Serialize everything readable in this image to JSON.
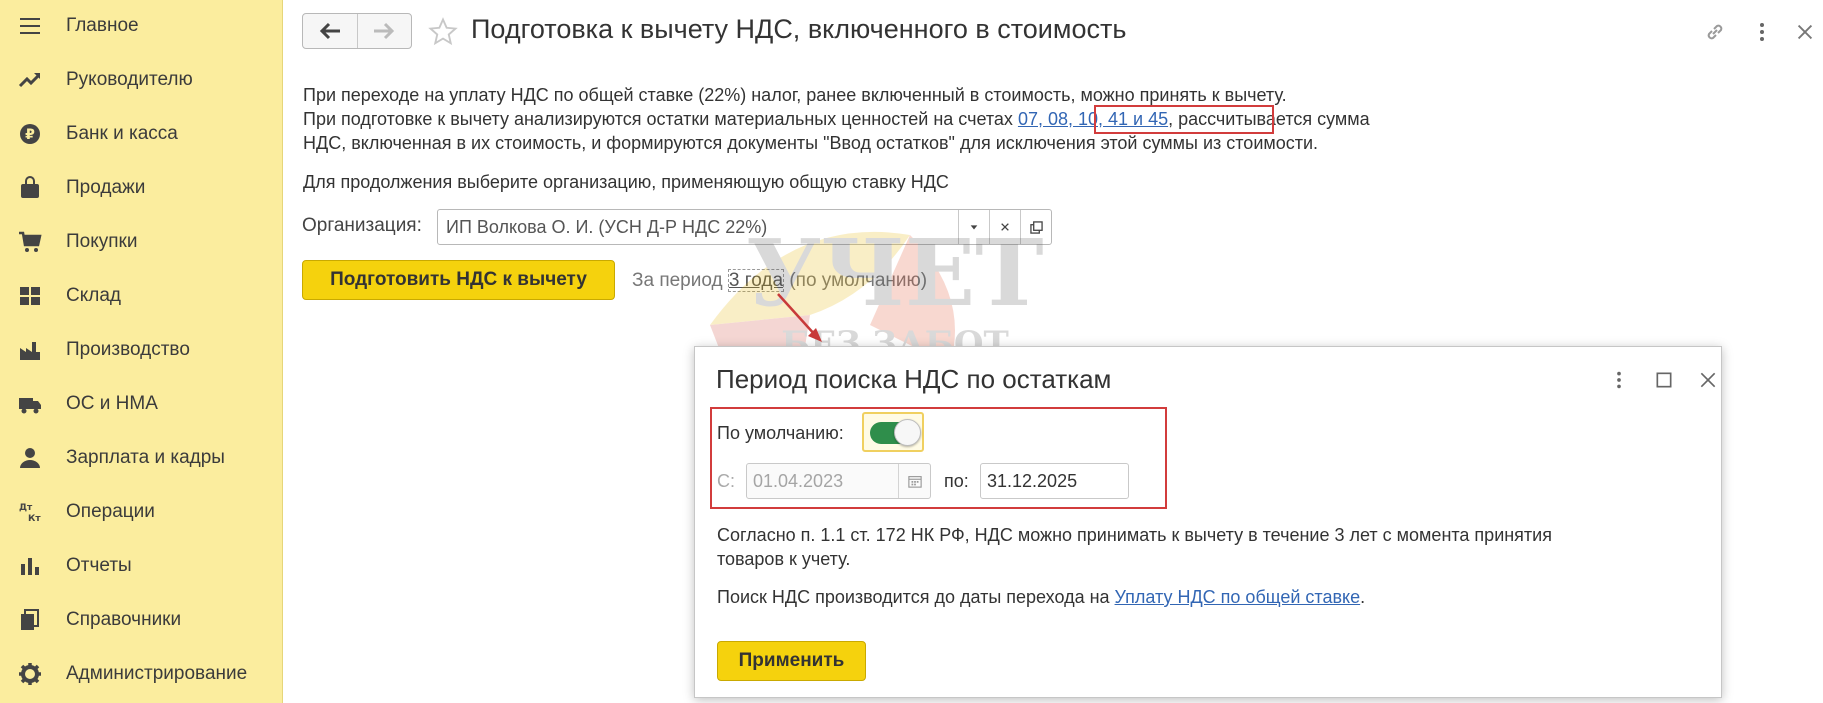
{
  "sidebar": {
    "items": [
      {
        "label": "Главное",
        "icon": "menu-icon"
      },
      {
        "label": "Руководителю",
        "icon": "trend-icon"
      },
      {
        "label": "Банк и касса",
        "icon": "ruble-icon"
      },
      {
        "label": "Продажи",
        "icon": "shopping-bag-icon"
      },
      {
        "label": "Покупки",
        "icon": "cart-icon"
      },
      {
        "label": "Склад",
        "icon": "warehouse-icon"
      },
      {
        "label": "Производство",
        "icon": "factory-icon"
      },
      {
        "label": "ОС и НМА",
        "icon": "truck-icon"
      },
      {
        "label": "Зарплата и кадры",
        "icon": "person-icon"
      },
      {
        "label": "Операции",
        "icon": "dt-kt-icon"
      },
      {
        "label": "Отчеты",
        "icon": "bar-chart-icon"
      },
      {
        "label": "Справочники",
        "icon": "books-icon"
      },
      {
        "label": "Администрирование",
        "icon": "gear-icon"
      }
    ]
  },
  "header": {
    "title": "Подготовка к вычету НДС, включенного в стоимость"
  },
  "intro": {
    "line1": "При переходе на уплату НДС по общей ставке (22%) налог, ранее включенный в стоимость, можно принять к вычету.",
    "line2_before": "При подготовке к вычету анализируются остатки материальных ценностей на счетах ",
    "accounts_link": "07, 08, 10, 41 и 45",
    "line2_after": ", рассчитывается сумма",
    "line3": "НДС, включенная в их стоимость, и формируются документы \"Ввод остатков\" для исключения этой суммы из стоимости.",
    "line4": "Для продолжения выберите организацию, применяющую общую ставку НДС"
  },
  "org": {
    "label": "Организация:",
    "value": "ИП Волкова О. И. (УСН Д-Р НДС 22%)"
  },
  "actions": {
    "prepare_label": "Подготовить НДС к вычету",
    "period_prefix": "За период ",
    "period_link": "3 года",
    "period_suffix": " (по умолчанию)"
  },
  "watermark": {
    "line1": "УЧЕТ",
    "line2": "БЕЗ ЗАБОТ"
  },
  "dialog": {
    "title": "Период поиска НДС по остаткам",
    "default_label": "По умолчанию:",
    "default_on": true,
    "from_label": "С:",
    "from_value": "01.04.2023",
    "to_label": "по:",
    "to_value": "31.12.2025",
    "note1": "Согласно п. 1.1 ст. 172 НК РФ, НДС можно принимать к вычету в течение 3 лет с момента принятия",
    "note2": "товаров к учету.",
    "search_before": "Поиск НДС производится до даты перехода на ",
    "search_link": "Уплату НДС по общей ставке",
    "search_after": ".",
    "apply_label": "Применить"
  },
  "colors": {
    "sidebar_bg": "#fbed9e",
    "accent_yellow": "#f5d20d",
    "link": "#3266b4",
    "highlight_red": "#d23c3c",
    "toggle_on": "#2f8e4b"
  }
}
